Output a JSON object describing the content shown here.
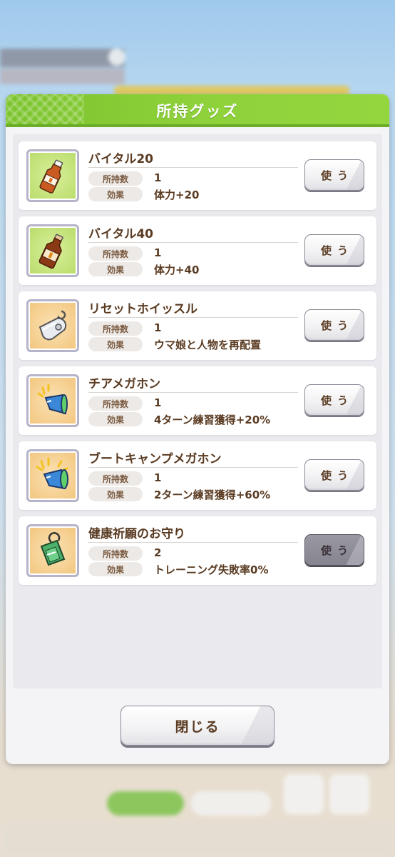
{
  "dialog": {
    "title": "所持グッズ",
    "close_label": "閉じる"
  },
  "labels": {
    "count_label": "所持数",
    "effect_label": "効果",
    "use_label": "使う"
  },
  "items": [
    {
      "name": "バイタル20",
      "count": "1",
      "effect": "体力+20",
      "icon": "drink-bottle-icon",
      "use_enabled": true
    },
    {
      "name": "バイタル40",
      "count": "1",
      "effect": "体力+40",
      "icon": "drink-bottle-icon",
      "use_enabled": true
    },
    {
      "name": "リセットホイッスル",
      "count": "1",
      "effect": "ウマ娘と人物を再配置",
      "icon": "whistle-icon",
      "use_enabled": true
    },
    {
      "name": "チアメガホン",
      "count": "1",
      "effect": "4ターン練習獲得+20%",
      "icon": "megaphone-icon",
      "use_enabled": true
    },
    {
      "name": "ブートキャンプメガホン",
      "count": "1",
      "effect": "2ターン練習獲得+60%",
      "icon": "megaphone-icon",
      "use_enabled": true
    },
    {
      "name": "健康祈願のお守り",
      "count": "2",
      "effect": "トレーニング失敗率0%",
      "icon": "amulet-icon",
      "use_enabled": false
    }
  ],
  "colors": {
    "header_green": "#8ed13a",
    "text_brown": "#5a3b22"
  }
}
